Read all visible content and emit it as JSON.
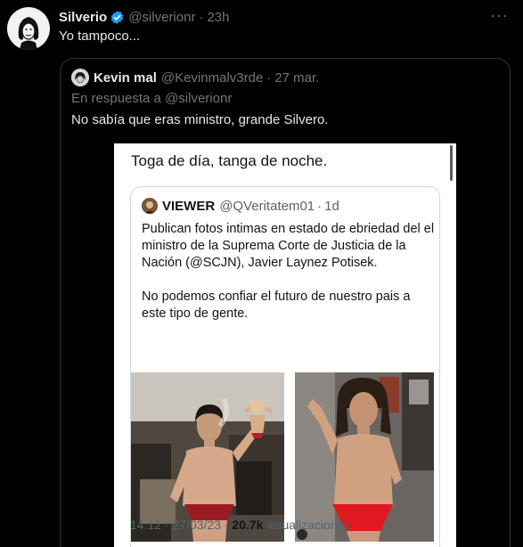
{
  "tweet": {
    "author_name": "Silverio",
    "handle": "@silverionr",
    "separator": "·",
    "time": "23h",
    "text": "Yo tampoco...",
    "more_icon": "more-horizontal-icon"
  },
  "quoted": {
    "author_name": "Kevin mal",
    "handle": "@Kevinmalv3rde",
    "separator": "·",
    "date": "27 mar.",
    "reply_to": "En respuesta a @silverionr",
    "text": "No sabía que eras ministro, grande Silvero."
  },
  "screenshot": {
    "title": "Toga de día, tanga de noche.",
    "card": {
      "author_name": "VIEWER",
      "handle": "@QVeritatem01",
      "separator": "·",
      "age": "1d",
      "paragraph1": "Publican fotos intimas en estado de ebriedad del el ministro de la Suprema Corte de Justicia de la Nación (@SCJN), Javier Laynez Potisek.",
      "paragraph2": "No podemos confiar el futuro de nuestro pais a este tipo de gente."
    },
    "footer": {
      "time": "14:12 · 27/03/23 ·",
      "views_count": "20.7k",
      "views_label": "visualizaciones"
    }
  },
  "colors": {
    "background": "#000000",
    "text": "#e7e9ea",
    "muted": "#71767b",
    "verified": "#1d9bf0",
    "border": "#2f3336"
  }
}
